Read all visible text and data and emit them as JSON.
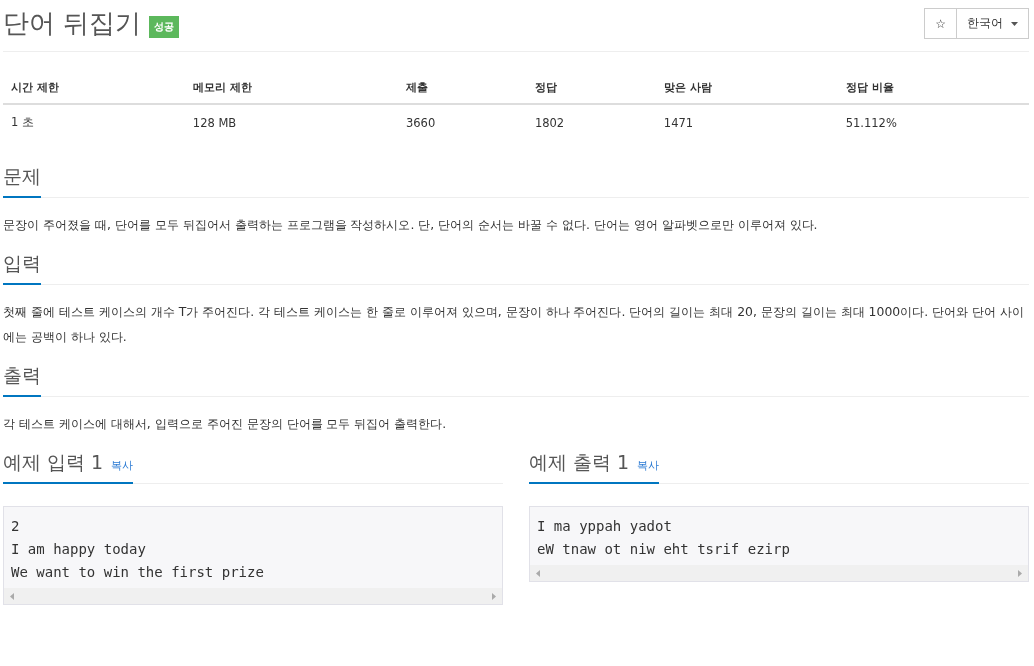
{
  "header": {
    "title": "단어 뒤집기",
    "badge": "성공",
    "star_button": "☆",
    "language_button": "한국어"
  },
  "stats": {
    "columns": [
      "시간 제한",
      "메모리 제한",
      "제출",
      "정답",
      "맞은 사람",
      "정답 비율"
    ],
    "row": [
      "1 초",
      "128 MB",
      "3660",
      "1802",
      "1471",
      "51.112%"
    ]
  },
  "sections": [
    {
      "heading": "문제",
      "body": "문장이 주어졌을 때, 단어를 모두 뒤집어서 출력하는 프로그램을 작성하시오. 단, 단어의 순서는 바꿀 수 없다. 단어는 영어 알파벳으로만 이루어져 있다."
    },
    {
      "heading": "입력",
      "body": "첫째 줄에 테스트 케이스의 개수 T가 주어진다. 각 테스트 케이스는 한 줄로 이루어져 있으며, 문장이 하나 주어진다. 단어의 길이는 최대 20, 문장의 길이는 최대 1000이다. 단어와 단어 사이에는 공백이 하나 있다."
    },
    {
      "heading": "출력",
      "body": "각 테스트 케이스에 대해서, 입력으로 주어진 문장의 단어를 모두 뒤집어 출력한다."
    }
  ],
  "samples": [
    {
      "heading": "예제 입력 1",
      "copy": "복사",
      "lines": [
        "2",
        "I am happy today",
        "We want to win the first prize"
      ]
    },
    {
      "heading": "예제 출력 1",
      "copy": "복사",
      "lines": [
        "I ma yppah yadot",
        "eW tnaw ot niw eht tsrif ezirp"
      ]
    }
  ]
}
